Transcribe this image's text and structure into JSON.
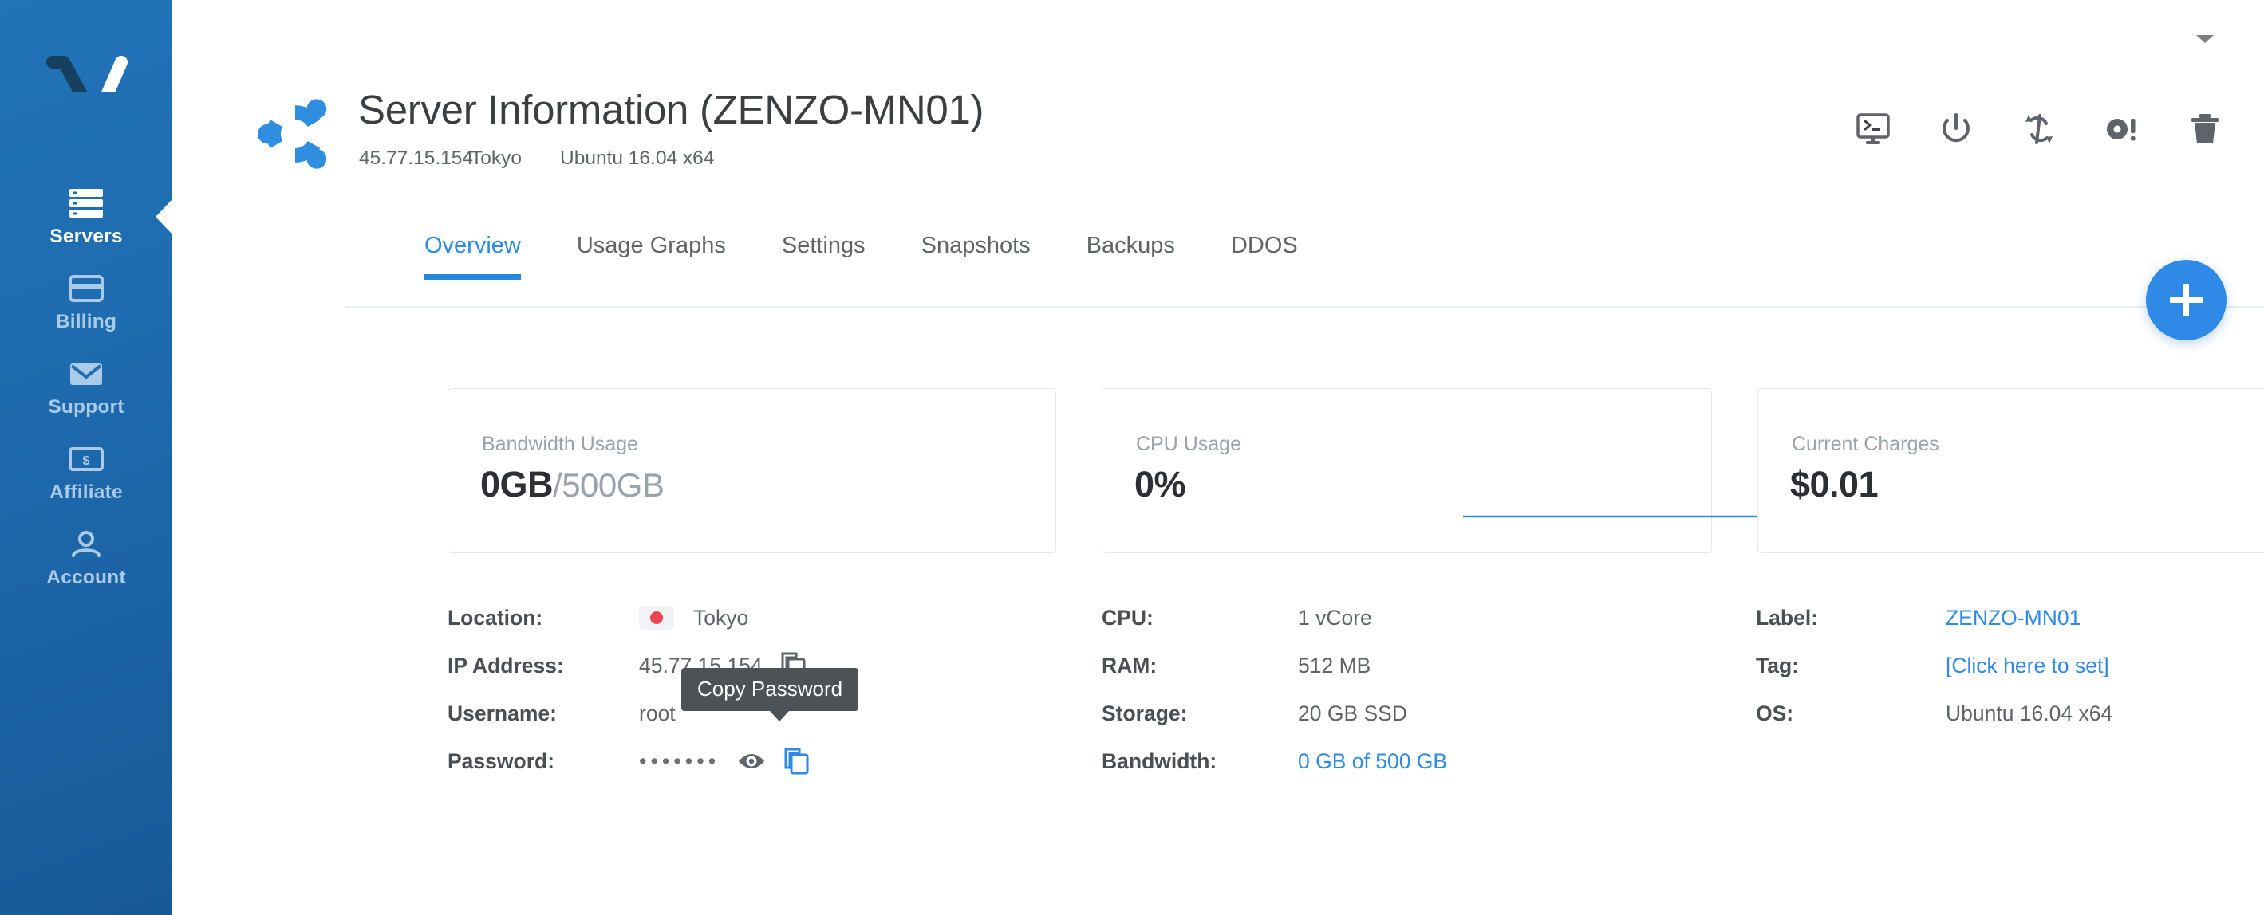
{
  "sidebar": {
    "logo_name": "vultr-logo",
    "items": [
      {
        "label": "Servers",
        "icon": "servers-icon",
        "active": true
      },
      {
        "label": "Billing",
        "icon": "billing-icon",
        "active": false
      },
      {
        "label": "Support",
        "icon": "support-icon",
        "active": false
      },
      {
        "label": "Affiliate",
        "icon": "affiliate-icon",
        "active": false
      },
      {
        "label": "Account",
        "icon": "account-icon",
        "active": false
      }
    ]
  },
  "header": {
    "os_logo": "ubuntu-logo",
    "title": "Server Information (ZENZO-MN01)",
    "meta": {
      "ip": "45.77.15.154",
      "location": "Tokyo",
      "os": "Ubuntu 16.04 x64"
    },
    "actions": [
      {
        "name": "console-icon",
        "label": "View Console"
      },
      {
        "name": "power-icon",
        "label": "Server Stop"
      },
      {
        "name": "restart-icon",
        "label": "Server Restart"
      },
      {
        "name": "reinstall-icon",
        "label": "Server Reinstall"
      },
      {
        "name": "trash-icon",
        "label": "Server Destroy"
      }
    ],
    "caret": "chevron-down-icon"
  },
  "tabs": [
    {
      "label": "Overview",
      "active": true
    },
    {
      "label": "Usage Graphs",
      "active": false
    },
    {
      "label": "Settings",
      "active": false
    },
    {
      "label": "Snapshots",
      "active": false
    },
    {
      "label": "Backups",
      "active": false
    },
    {
      "label": "DDOS",
      "active": false
    }
  ],
  "fab": {
    "label": "+",
    "icon": "plus-icon"
  },
  "cards": [
    {
      "label": "Bandwidth Usage",
      "value": "0GB",
      "sub": "/500GB",
      "sparkline": false
    },
    {
      "label": "CPU Usage",
      "value": "0%",
      "sub": "",
      "sparkline": true
    },
    {
      "label": "Current Charges",
      "value": "$0.01",
      "sub": "",
      "sparkline": false
    }
  ],
  "details": {
    "col1": [
      {
        "key": "Location:",
        "value": "Tokyo",
        "flag": "japan-flag",
        "link": false,
        "copy": false
      },
      {
        "key": "IP Address:",
        "value": "45.77.15.154",
        "flag": null,
        "link": false,
        "copy": true
      },
      {
        "key": "Username:",
        "value": "root",
        "flag": null,
        "link": false,
        "copy": false
      },
      {
        "key": "Password:",
        "value": "•••••••",
        "flag": null,
        "link": false,
        "copy": true
      }
    ],
    "col2": [
      {
        "key": "CPU:",
        "value": "1 vCore",
        "link": false
      },
      {
        "key": "RAM:",
        "value": "512 MB",
        "link": false
      },
      {
        "key": "Storage:",
        "value": "20 GB SSD",
        "link": false
      },
      {
        "key": "Bandwidth:",
        "value": "0 GB of 500 GB",
        "link": true
      }
    ],
    "col3": [
      {
        "key": "Label:",
        "value": "ZENZO-MN01",
        "link": true
      },
      {
        "key": "Tag:",
        "value": "[Click here to set]",
        "link": true
      },
      {
        "key": "OS:",
        "value": "Ubuntu 16.04 x64",
        "link": false
      }
    ]
  },
  "tooltip": {
    "text": "Copy Password"
  },
  "colors": {
    "sidebar_top": "#2273b8",
    "sidebar_bottom": "#185a97",
    "accent_blue": "#2e8ae6",
    "tab_underline": "#2787dd",
    "link_blue": "#2e8ae6",
    "text_dark": "#3c3f42",
    "text_muted": "#9aa2aa",
    "tooltip_bg": "#4c5256",
    "flag_red": "#ef4452",
    "ubuntu_blue": "#2f8ee0"
  }
}
